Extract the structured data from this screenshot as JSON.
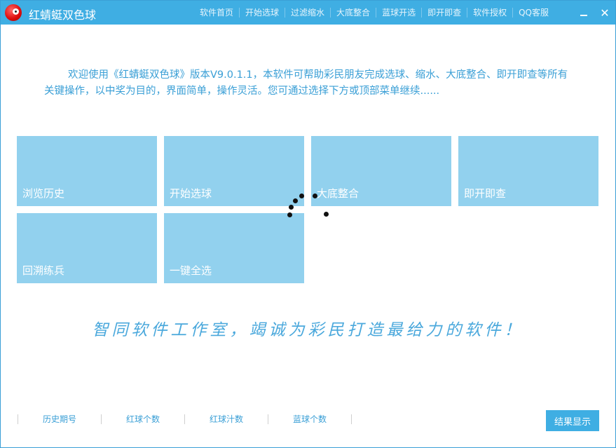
{
  "window": {
    "title": "红蜻蜓双色球",
    "nav": [
      "软件首页",
      "开始选球",
      "过滤缩水",
      "大底整合",
      "蓝球开选",
      "即开即查",
      "软件授权",
      "QQ客服"
    ],
    "minimize_label": "",
    "close_label": "✕"
  },
  "welcome": {
    "text": "欢迎使用《红蜻蜓双色球》版本V9.0.1.1，本软件可帮助彩民朋友完成选球、缩水、大底整合、即开即查等所有关键操作，以中奖为目的，界面简单，操作灵活。您可通过选择下方或顶部菜单继续......"
  },
  "tiles": [
    {
      "label": "浏览历史"
    },
    {
      "label": "开始选球"
    },
    {
      "label": "大底整合"
    },
    {
      "label": "即开即查"
    },
    {
      "label": "回溯练兵"
    },
    {
      "label": "一键全选"
    }
  ],
  "slogan": "智同软件工作室，竭诚为彩民打造最给力的软件！",
  "bottom": {
    "columns": [
      "历史期号",
      "红球个数",
      "红球汁数",
      "蓝球个数"
    ],
    "result_button": "结果显示"
  },
  "colors": {
    "titlebar": "#3faee3",
    "tile": "#92d1ee",
    "text_accent": "#3a9fd6"
  }
}
